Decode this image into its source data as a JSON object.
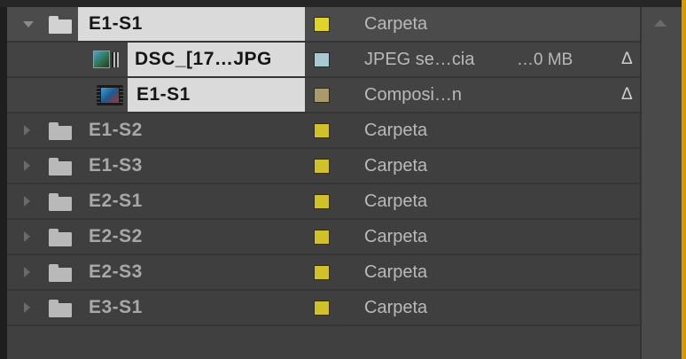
{
  "colors": {
    "folder_label": "#e0d32a",
    "folder_label_dim": "#cfc128",
    "jpeg_label": "#a8c9d2",
    "comp_label": "#a89a6a",
    "accent_border": "#d99a00"
  },
  "rows": [
    {
      "name": "E1-S1",
      "type": "Carpeta",
      "size": "",
      "delta": "",
      "icon": "folder-icon",
      "expanded": true
    },
    {
      "name": "DSC_[17…JPG",
      "type": "JPEG se…cia",
      "size": "…0 MB",
      "delta": "Δ",
      "icon": "image-sequence-icon"
    },
    {
      "name": "E1-S1",
      "type": "Composi…n",
      "size": "",
      "delta": "Δ",
      "icon": "composition-icon"
    },
    {
      "name": "E1-S2",
      "type": "Carpeta",
      "icon": "folder-icon",
      "expanded": false
    },
    {
      "name": "E1-S3",
      "type": "Carpeta",
      "icon": "folder-icon",
      "expanded": false
    },
    {
      "name": "E2-S1",
      "type": "Carpeta",
      "icon": "folder-icon",
      "expanded": false
    },
    {
      "name": "E2-S2",
      "type": "Carpeta",
      "icon": "folder-icon",
      "expanded": false
    },
    {
      "name": "E2-S3",
      "type": "Carpeta",
      "icon": "folder-icon",
      "expanded": false
    },
    {
      "name": "E3-S1",
      "type": "Carpeta",
      "icon": "folder-icon",
      "expanded": false
    }
  ]
}
